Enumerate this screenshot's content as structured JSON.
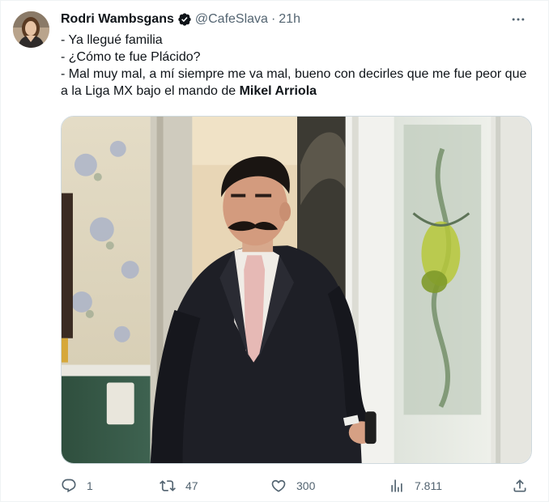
{
  "author": {
    "display_name": "Rodri Wambsgans",
    "handle": "@CafeSlava",
    "separator": "·",
    "time": "21h",
    "verified_icon": "verified-badge-icon"
  },
  "tweet": {
    "lines": [
      "- Ya llegué familia",
      "- ¿Cómo te fue Plácido?",
      "- Mal muy mal, a mí siempre me va mal, bueno con decirles que me fue peor que a la Liga MX bajo el mando de "
    ],
    "bold_tail": "Mikel Arriola"
  },
  "actions": {
    "reply": {
      "icon": "reply-icon",
      "count": "1"
    },
    "retweet": {
      "icon": "retweet-icon",
      "count": "47"
    },
    "like": {
      "icon": "heart-icon",
      "count": "300"
    },
    "views": {
      "icon": "views-icon",
      "count": "7.811"
    },
    "share": {
      "icon": "share-icon"
    }
  },
  "colors": {
    "text": "#0f1419",
    "secondary": "#536471",
    "border": "#cfd9de",
    "accent": "#1d9bf0"
  }
}
